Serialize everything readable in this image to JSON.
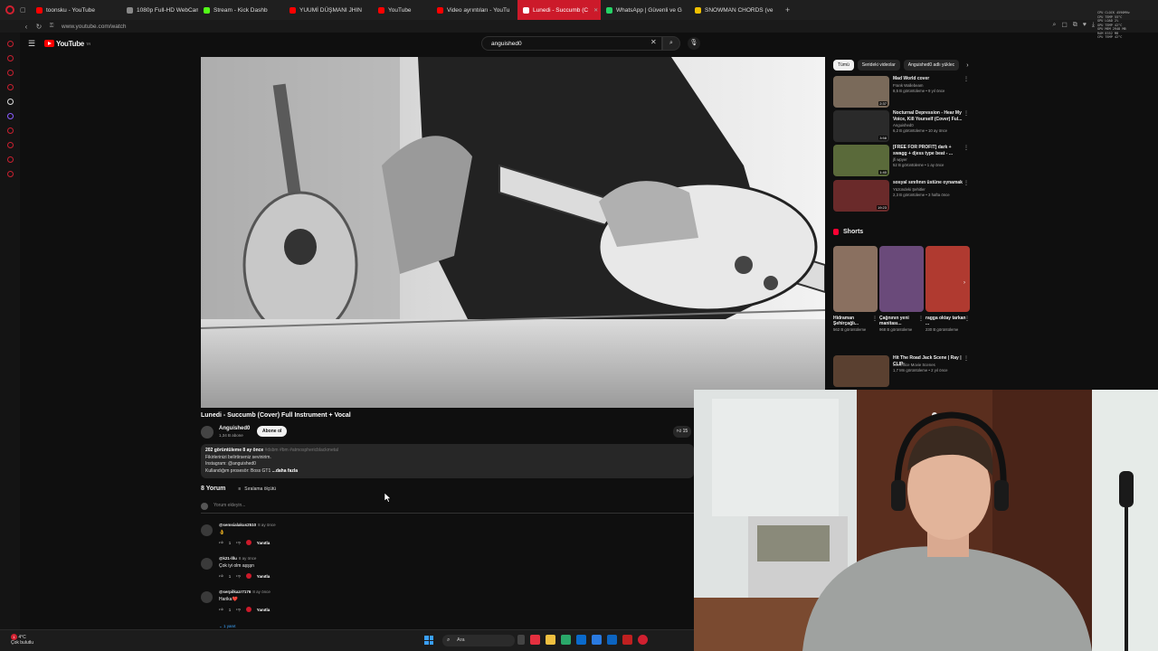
{
  "browser": {
    "tabs": [
      {
        "label": "toonsku - YouTube",
        "color": "#ff0000",
        "active": false
      },
      {
        "label": "1080p Full-HD WebCam",
        "color": "#888888",
        "active": false
      },
      {
        "label": "Stream - Kick Dashb",
        "color": "#53fc18",
        "active": false
      },
      {
        "label": "YUUMİ DÜŞMANI JHIN",
        "color": "#ff0000",
        "active": false
      },
      {
        "label": "YouTube",
        "color": "#ff0000",
        "active": false
      },
      {
        "label": "Video ayrıntıları - YouTu",
        "color": "#ff0000",
        "active": false
      },
      {
        "label": "Lunedi - Succumb (C",
        "color": "#ffffff",
        "active": true
      },
      {
        "label": "WhatsApp | Güvenli ve G",
        "color": "#25d366",
        "active": false
      },
      {
        "label": "SNOWMAN CHORDS (ve",
        "color": "#f0c000",
        "active": false
      }
    ],
    "new_tab": "+",
    "url": "www.youtube.com/watch"
  },
  "header": {
    "logo_text": "YouTube",
    "logo_country": "TR",
    "search_value": "anguished0"
  },
  "video": {
    "title": "Lunedi - Succumb (Cover) Full Instrument + Vocal",
    "channel": "Anguished0",
    "subscribers": "1,34 B abone",
    "subscribe_label": "Abone ol",
    "likes": "15"
  },
  "description": {
    "meta": "202 görüntüleme  8 ay önce",
    "tags": "#dsbm #bm #atmosphericblackmetal",
    "line1": "Fikirlerinizi belirtirseniz sevinirim.",
    "line2": "Instagram: @anguished0",
    "line3": "Kullandığım prosesör: Boss GT1",
    "more": "...daha fazla"
  },
  "comments": {
    "count_label": "8 Yorum",
    "sort_label": "Sıralama ölçütü",
    "add_placeholder": "Yorum ekleyin...",
    "items": [
      {
        "user": "@semsialakus2510",
        "time": "8 ay önce",
        "text": "👌",
        "likes": "1",
        "reply": "Yanıtla"
      },
      {
        "user": "@k21-lllu",
        "time": "8 ay önce",
        "text": "Çok iyi olm aşşşn",
        "likes": "1",
        "reply": "Yanıtla"
      },
      {
        "user": "@serpilkazr7176",
        "time": "8 ay önce",
        "text": "Harika❤️",
        "likes": "1",
        "reply": "Yanıtla"
      }
    ],
    "replies_label": "1 yanıt"
  },
  "chips": [
    "Tümü",
    "Serideki videolar",
    "Anguished0 adlı yüklec"
  ],
  "recommendations": [
    {
      "title": "Mad World cover",
      "channel": "Frank Wallebeam",
      "stats": "8,5 B görüntüleme • 9 yıl önce",
      "duration": "2:37",
      "thumb": "#7a6a5a"
    },
    {
      "title": "Nocturnal Depression - Hear My Voice, Kill Yourself (Cover) Ful...",
      "channel": "Anguished0",
      "stats": "6,2 B görüntüleme • 10 ay önce",
      "duration": "3:58",
      "thumb": "#2a2a2a"
    },
    {
      "title": "[FREE FOR PROFIT] dark + swagg + djess type beat - ...",
      "channel": "jfi wpyer",
      "stats": "52 B görüntüleme • 1 ay önce",
      "duration": "1:40",
      "thumb": "#5a6a3a"
    },
    {
      "title": "sosyal sınıfının üstüne oynamak",
      "channel": "Yüzündeki Şehitler",
      "stats": "2,3 B görüntüleme • 3 hafta önce",
      "duration": "19:23",
      "thumb": "#6a2a2a"
    },
    {
      "title": "Hit The Road Jack Scene | Ray | CLIP",
      "channel": "BoxOffice Movie Scenes",
      "stats": "1,7 Mn görüntüleme • 2 yıl önce",
      "duration": "",
      "thumb": "#5a4030"
    }
  ],
  "shorts": {
    "heading": "Shorts",
    "items": [
      {
        "title": "Hidraman Şehirçağlı...",
        "views": "562 B görüntüleme",
        "thumb": "#8a7060"
      },
      {
        "title": "Çağnının yeni manitası...",
        "views": "968 B görüntüleme",
        "thumb": "#6a4a7a"
      },
      {
        "title": "ragga oktay tarkan ...",
        "views": "230 B görüntüleme",
        "thumb": "#b03a30"
      }
    ]
  },
  "taskbar": {
    "temp": "4°C",
    "weather": "Çok bulutlu",
    "notif": "1",
    "search_placeholder": "Ara"
  },
  "perf": [
    "CPU CLOCK 4590MHz",
    "CPU TEMP 55°C",
    "GPU LOAD 2%",
    "GPU TEMP 42°C",
    "GPU MEM 2948 MB",
    "RAM 8352 MB",
    "CPU TEMP 42°C"
  ]
}
